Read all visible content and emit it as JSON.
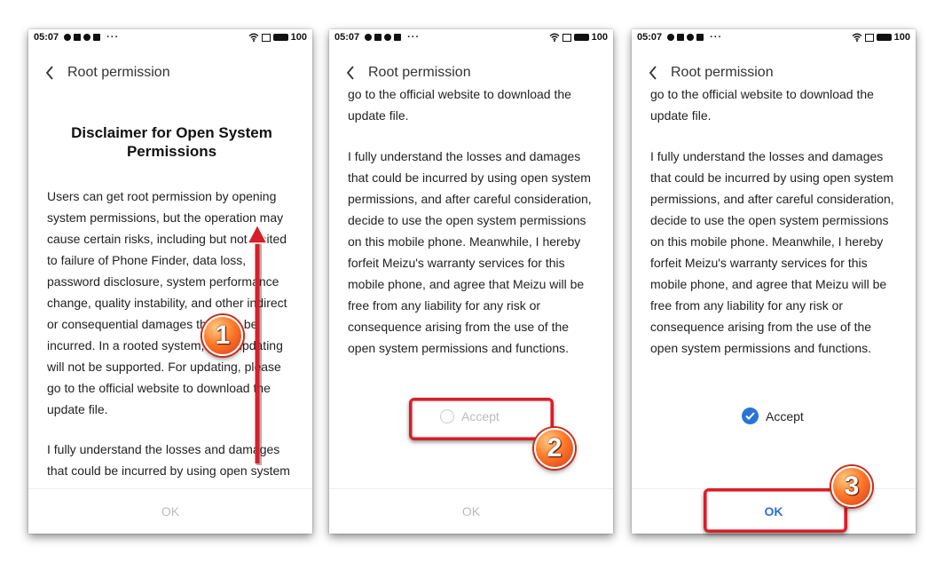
{
  "status_bar": {
    "time": "05:07",
    "battery": "100",
    "more": "···"
  },
  "header": {
    "title": "Root permission"
  },
  "screen1": {
    "heading": "Disclaimer for Open System Permissions",
    "para1": "Users can get root permission by opening system permissions, but the operation may cause certain risks, including but not limited to failure of Phone Finder, data loss, password disclosure, system performance change, quality instability, and other indirect or consequential damages that can be incurred. In a rooted system, OTA updating will not be supported. For updating, please go to the official website to download the update file.",
    "para2": "I fully understand the losses and damages that could be incurred by using open system permissions, and after careful consideration, decide to use the open",
    "ok_label": "OK"
  },
  "screen2": {
    "top_text": "go to the official website to download the update file.",
    "para": "I fully understand the losses and damages that could be incurred by using open system permissions, and after careful consideration, decide to use the open system permissions on this mobile phone. Meanwhile, I hereby forfeit Meizu's warranty services for this mobile phone, and agree that Meizu will be free from any liability for any risk or consequence arising from the use of the open system permissions and functions.",
    "accept_label": "Accept",
    "accept_checked": false,
    "ok_label": "OK"
  },
  "screen3": {
    "top_text": "go to the official website to download the update file.",
    "para": "I fully understand the losses and damages that could be incurred by using open system permissions, and after careful consideration, decide to use the open system permissions on this mobile phone. Meanwhile, I hereby forfeit Meizu's warranty services for this mobile phone, and agree that Meizu will be free from any liability for any risk or consequence arising from the use of the open system permissions and functions.",
    "accept_label": "Accept",
    "accept_checked": true,
    "ok_label": "OK"
  },
  "annotations": {
    "step1": "1",
    "step2": "2",
    "step3": "3",
    "highlight_color": "#d4202a"
  },
  "colors": {
    "accent": "#2a74d6",
    "disabled": "#bbbbbb"
  }
}
